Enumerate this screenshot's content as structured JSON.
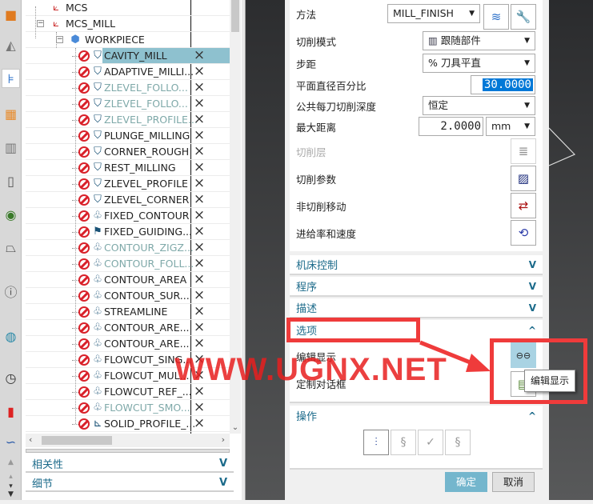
{
  "left_toolbar": {
    "icons": [
      "machine-tool-icon",
      "geometry-icon",
      "operation-navigator-icon",
      "feature-table-icon",
      "assembly-icon",
      "library-icon",
      "eye-icon",
      "shape-icon",
      "info-icon",
      "web-browser-icon",
      "clock-icon",
      "color-palette-icon",
      "curve-icon"
    ]
  },
  "tree": {
    "nodes": [
      {
        "label": "MCS",
        "icon": "mcs-icon",
        "level": 1,
        "status": "",
        "dim": false
      },
      {
        "label": "MCS_MILL",
        "icon": "mcs-icon",
        "level": 1,
        "status": "",
        "dim": false
      },
      {
        "label": "WORKPIECE",
        "icon": "workpiece-icon",
        "level": 2,
        "status": "",
        "dim": false
      }
    ],
    "operations": [
      {
        "label": "CAVITY_MILL",
        "dim": false,
        "selected": true,
        "icon": "cavity-mill-icon"
      },
      {
        "label": "ADAPTIVE_MILLI...",
        "dim": false,
        "selected": false,
        "icon": "adaptive-mill-icon"
      },
      {
        "label": "ZLEVEL_FOLLO...",
        "dim": true,
        "selected": false,
        "icon": "zlevel-icon"
      },
      {
        "label": "ZLEVEL_FOLLO...",
        "dim": true,
        "selected": false,
        "icon": "zlevel-icon"
      },
      {
        "label": "ZLEVEL_PROFILE...",
        "dim": true,
        "selected": false,
        "icon": "zlevel-icon"
      },
      {
        "label": "PLUNGE_MILLING",
        "dim": false,
        "selected": false,
        "icon": "plunge-icon"
      },
      {
        "label": "CORNER_ROUGH",
        "dim": false,
        "selected": false,
        "icon": "corner-rough-icon"
      },
      {
        "label": "REST_MILLING",
        "dim": false,
        "selected": false,
        "icon": "rest-mill-icon"
      },
      {
        "label": "ZLEVEL_PROFILE",
        "dim": false,
        "selected": false,
        "icon": "zlevel-icon"
      },
      {
        "label": "ZLEVEL_CORNER",
        "dim": false,
        "selected": false,
        "icon": "zlevel-icon"
      },
      {
        "label": "FIXED_CONTOUR",
        "dim": false,
        "selected": false,
        "icon": "contour-icon"
      },
      {
        "label": "FIXED_GUIDING...",
        "dim": false,
        "selected": false,
        "icon": "fixed-guiding-icon"
      },
      {
        "label": "CONTOUR_ZIGZ...",
        "dim": true,
        "selected": false,
        "icon": "contour-icon"
      },
      {
        "label": "CONTOUR_FOLL...",
        "dim": true,
        "selected": false,
        "icon": "contour-icon"
      },
      {
        "label": "CONTOUR_AREA",
        "dim": false,
        "selected": false,
        "icon": "contour-icon"
      },
      {
        "label": "CONTOUR_SUR...",
        "dim": false,
        "selected": false,
        "icon": "contour-icon"
      },
      {
        "label": "STREAMLINE",
        "dim": false,
        "selected": false,
        "icon": "contour-icon"
      },
      {
        "label": "CONTOUR_ARE...",
        "dim": false,
        "selected": false,
        "icon": "contour-icon"
      },
      {
        "label": "CONTOUR_ARE...",
        "dim": false,
        "selected": false,
        "icon": "contour-icon"
      },
      {
        "label": "FLOWCUT_SING...",
        "dim": false,
        "selected": false,
        "icon": "contour-icon"
      },
      {
        "label": "FLOWCUT_MUL...",
        "dim": false,
        "selected": false,
        "icon": "contour-icon"
      },
      {
        "label": "FLOWCUT_REF_...",
        "dim": false,
        "selected": false,
        "icon": "contour-icon"
      },
      {
        "label": "FLOWCUT_SMO...",
        "dim": true,
        "selected": false,
        "icon": "contour-icon"
      },
      {
        "label": "SOLID_PROFILE_...",
        "dim": false,
        "selected": false,
        "icon": "solid-profile-icon"
      }
    ],
    "status_mark": "×"
  },
  "nav_sections": [
    {
      "label": "相关性",
      "chevron": "V"
    },
    {
      "label": "细节",
      "chevron": "V"
    }
  ],
  "dialog": {
    "fields": {
      "method_label": "方法",
      "method_value": "MILL_FINISH",
      "cut_pattern_label": "切削模式",
      "cut_pattern_value": "跟随部件",
      "stepover_label": "步距",
      "stepover_value": "% 刀具平直",
      "percent_label": "平面直径百分比",
      "percent_value": "30.0000",
      "depth_label": "公共每刀切削深度",
      "depth_value": "恒定",
      "maxdist_label": "最大距离",
      "maxdist_value": "2.0000",
      "maxdist_unit": "mm",
      "cut_levels_label": "切削层",
      "cut_params_label": "切削参数",
      "noncut_label": "非切削移动",
      "feeds_label": "进给率和速度"
    },
    "sections": [
      {
        "label": "机床控制",
        "chevron": "V"
      },
      {
        "label": "程序",
        "chevron": "V"
      },
      {
        "label": "描述",
        "chevron": "V"
      },
      {
        "label": "选项",
        "chevron": "^"
      }
    ],
    "options": {
      "edit_display_label": "编辑显示",
      "custom_dialog_label": "定制对话框"
    },
    "actions_section": {
      "label": "操作",
      "chevron": "^"
    },
    "ok_label": "确定",
    "cancel_label": "取消"
  },
  "tooltip": "编辑显示",
  "watermark": "WWW.UGNX.NET",
  "colors": {
    "accent": "#1b6a8a",
    "selected_row": "#8ec1cf",
    "ok_button": "#74b6cd",
    "annotation_red": "#ef3b3b",
    "input_selection": "#0078d7"
  }
}
